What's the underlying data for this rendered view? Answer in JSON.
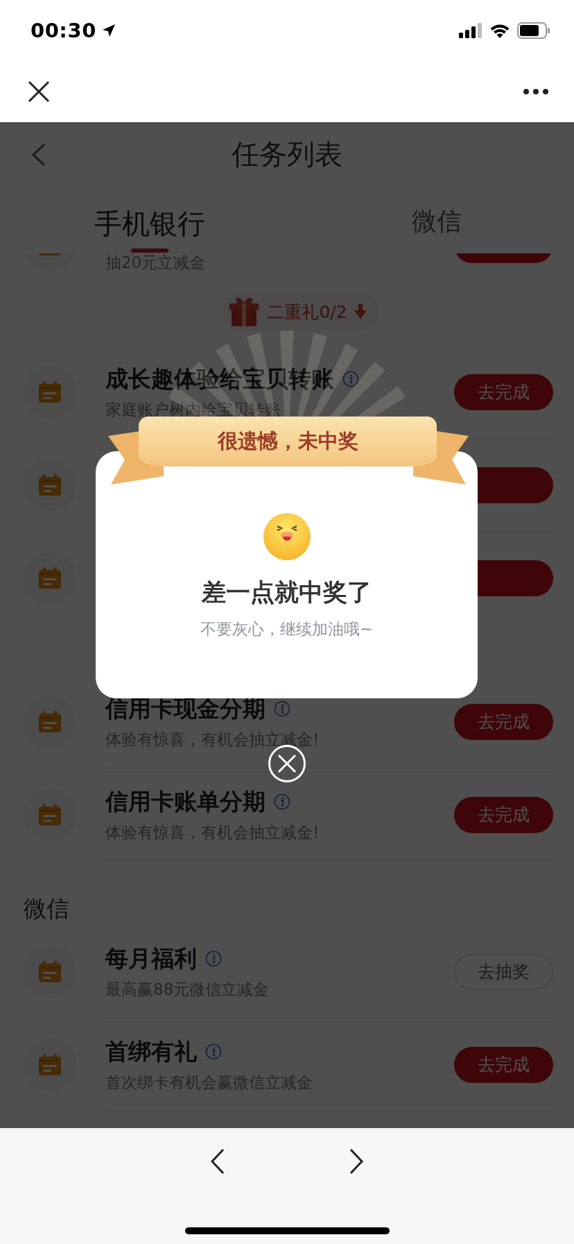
{
  "status_bar": {
    "time": "00:30"
  },
  "header": {
    "title": "任务列表"
  },
  "tabs": [
    {
      "label": "手机银行",
      "selected": true
    },
    {
      "label": "微信",
      "selected": false
    }
  ],
  "bank_tasks": [
    {
      "kind": "partial",
      "subtitle": "抽20元立减金",
      "button": {
        "kind": "filled"
      }
    },
    {
      "kind": "gift",
      "label": "二重礼0/2"
    },
    {
      "kind": "task",
      "title": "成长趣体验给宝贝转账",
      "subtitle": "家庭账户树内给宝贝转账",
      "button": {
        "label": "去完成",
        "kind": "filled"
      }
    },
    {
      "kind": "covered",
      "button": {
        "kind": "filled"
      }
    },
    {
      "kind": "covered",
      "button": {
        "kind": "filled"
      }
    }
  ],
  "credit_card_tasks": [
    {
      "kind": "task",
      "title": "信用卡现金分期",
      "subtitle": "体验有惊喜，有机会抽立减金!",
      "button": {
        "label": "去完成",
        "kind": "filled"
      }
    },
    {
      "kind": "task",
      "title": "信用卡账单分期",
      "subtitle": "体验有惊喜，有机会抽立减金!",
      "button": {
        "label": "去完成",
        "kind": "filled"
      }
    }
  ],
  "wechat_section": {
    "heading": "微信",
    "tasks": [
      {
        "kind": "task",
        "title": "每月福利",
        "subtitle": "最高赢88元微信立减金",
        "button": {
          "label": "去抽奖",
          "kind": "outline"
        }
      },
      {
        "kind": "task",
        "title": "首绑有礼",
        "subtitle": "首次绑卡有机会赢微信立减金",
        "button": {
          "label": "去完成",
          "kind": "filled"
        }
      }
    ]
  },
  "popup": {
    "banner": "很遗憾，未中奖",
    "title": "差一点就中奖了",
    "message": "不要灰心，继续加油哦~"
  }
}
